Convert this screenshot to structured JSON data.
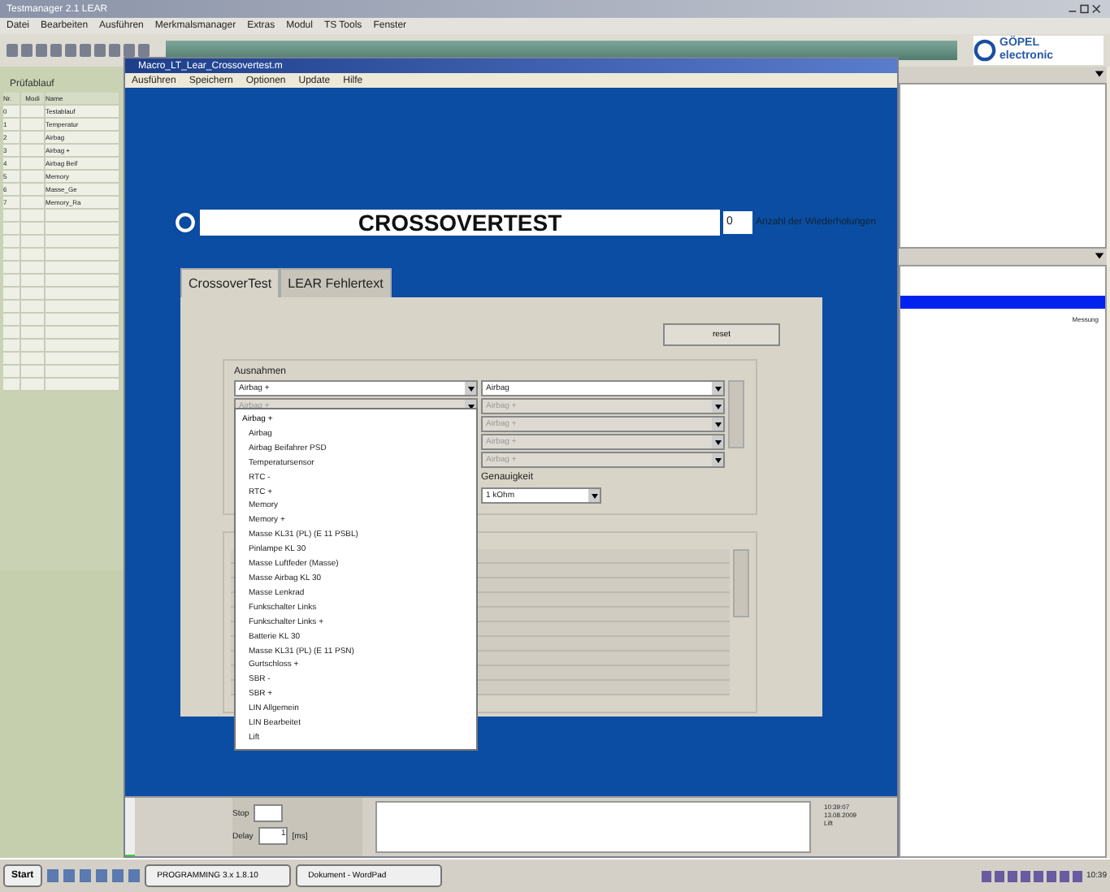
{
  "app": {
    "title": "Testmanager 2.1 LEAR",
    "menu": [
      "Datei",
      "Bearbeiten",
      "Ausführen",
      "Merkmalsmanager",
      "Extras",
      "Modul",
      "TS Tools",
      "Fenster"
    ],
    "logo_top": "GÖPEL",
    "logo_bottom": "electronic"
  },
  "left_panel": {
    "header": "Prüfablauf",
    "columns": [
      "Nr.",
      "Modi",
      "Name"
    ],
    "rows": [
      [
        "0",
        "",
        "Testablauf"
      ],
      [
        "1",
        "",
        "Temperatur"
      ],
      [
        "2",
        "",
        "Airbag"
      ],
      [
        "3",
        "",
        "Airbag +"
      ],
      [
        "4",
        "",
        "Airbag Beif"
      ],
      [
        "5",
        "",
        "Memory"
      ],
      [
        "6",
        "",
        "Masse_Ge"
      ],
      [
        "7",
        "",
        "Memory_Ra"
      ]
    ]
  },
  "right_panel": {
    "selected_text": "Messung"
  },
  "dialog": {
    "title": "Macro_LT_Lear_Crossovertest.m",
    "menu": [
      "Ausführen",
      "Speichern",
      "Optionen",
      "Update",
      "Hilfe"
    ],
    "test_name": "CROSSOVERTEST",
    "repetitions": "0",
    "repetitions_label": "Anzahl der Wiederholungen",
    "tabs": [
      {
        "label": "CrossoverTest",
        "selected": true
      },
      {
        "label": "LEAR Fehlertext",
        "selected": false
      }
    ],
    "reset_button": "reset",
    "group_label": "Ausnahmen",
    "left_combos": [
      {
        "value": "Airbag +",
        "disabled": false
      },
      {
        "value": "Airbag +",
        "disabled": true
      }
    ],
    "right_combos": [
      {
        "value": "Airbag",
        "disabled": false
      },
      {
        "value": "Airbag +",
        "disabled": true
      },
      {
        "value": "Airbag +",
        "disabled": true
      },
      {
        "value": "Airbag +",
        "disabled": true
      },
      {
        "value": "Airbag +",
        "disabled": true
      }
    ],
    "accuracy_label": "Genauigkeit",
    "accuracy": "1 kOhm",
    "dropdown_items": [
      {
        "label": "Airbag +",
        "selected": true
      },
      {
        "label": "Airbag",
        "selected": false
      },
      {
        "label": "Airbag Beifahrer PSD",
        "selected": false
      },
      {
        "label": "Temperatursensor",
        "selected": false
      },
      {
        "label": "RTC -",
        "selected": false
      },
      {
        "label": "RTC +",
        "selected": false
      },
      {
        "label": "Memory",
        "selected": false
      },
      {
        "label": "Memory +",
        "selected": false
      },
      {
        "label": "Masse KL31 (PL) (E 11 PSBL)",
        "selected": false
      },
      {
        "label": "Pinlampe KL 30",
        "selected": false
      },
      {
        "label": "Masse Luftfeder (Masse)",
        "selected": false
      },
      {
        "label": "Masse Airbag KL 30",
        "selected": false
      },
      {
        "label": "Masse Lenkrad",
        "selected": false
      },
      {
        "label": "Funkschalter Links",
        "selected": false
      },
      {
        "label": "Funkschalter Links +",
        "selected": false
      },
      {
        "label": "Batterie KL 30",
        "selected": false
      },
      {
        "label": "Masse KL31 (PL) (E 11 PSN)",
        "selected": false
      },
      {
        "label": "Gurtschloss +",
        "selected": false
      },
      {
        "label": "SBR -",
        "selected": false
      },
      {
        "label": "SBR +",
        "selected": false
      },
      {
        "label": "LIN Allgemein",
        "selected": false
      },
      {
        "label": "LIN Bearbeitet",
        "selected": false
      },
      {
        "label": "Lift",
        "selected": false
      }
    ],
    "status": {
      "stop_label": "Stop",
      "delay_label": "Delay",
      "delay": "1",
      "unit": "[ms]",
      "time": "10:39:07",
      "date": "13.08.2009",
      "extra": "Lift",
      "stop_checked": false,
      "level": 0.03
    }
  },
  "taskbar": {
    "start": "Start",
    "tasks": [
      "PROGRAMMING 3.x 1.8.10",
      "Dokument - WordPad"
    ],
    "clock": "10:39"
  }
}
